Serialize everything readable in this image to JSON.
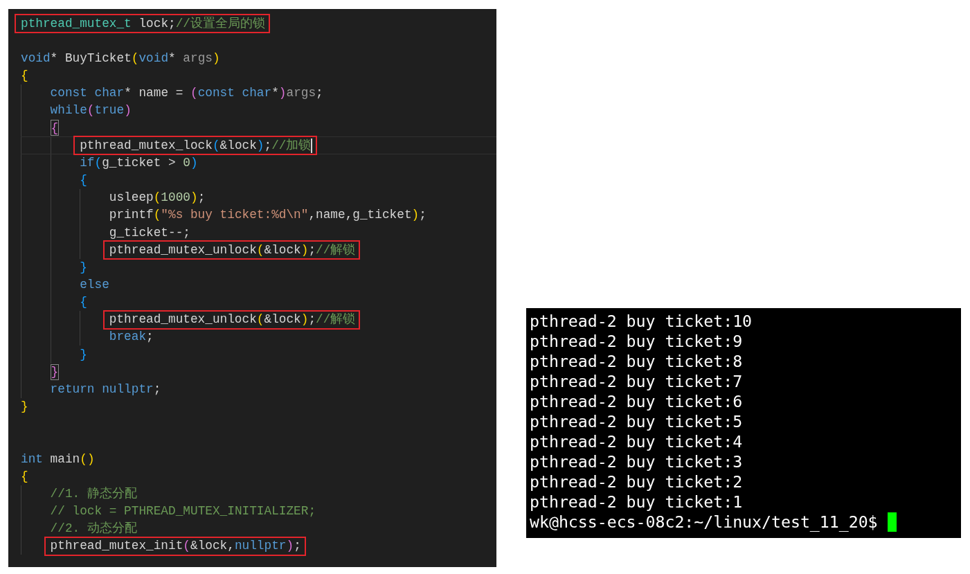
{
  "editor": {
    "lines": [
      {
        "kind": "code",
        "highlighted": true,
        "current": false,
        "matched": false,
        "tokens": [
          {
            "kind": "type",
            "text": "pthread_mutex_t"
          },
          {
            "kind": "plain",
            "text": " lock;"
          },
          {
            "kind": "comment",
            "text": "//设置全局的锁"
          }
        ]
      },
      {
        "kind": "blank"
      },
      {
        "kind": "code",
        "highlighted": false,
        "current": false,
        "matched": false,
        "tokens": [
          {
            "kind": "keyword",
            "text": "void"
          },
          {
            "kind": "plain",
            "text": "* BuyTicket"
          },
          {
            "kind": "bracket1",
            "text": "("
          },
          {
            "kind": "keyword",
            "text": "void"
          },
          {
            "kind": "plain",
            "text": "* "
          },
          {
            "kind": "param",
            "text": "args"
          },
          {
            "kind": "bracket1",
            "text": ")"
          }
        ]
      },
      {
        "kind": "code",
        "highlighted": false,
        "current": false,
        "matched": false,
        "tokens": [
          {
            "kind": "bracket1",
            "text": "{"
          }
        ],
        "children": [
          {
            "kind": "code",
            "highlighted": false,
            "current": false,
            "matched": false,
            "tokens": [
              {
                "kind": "keyword",
                "text": "const char"
              },
              {
                "kind": "plain",
                "text": "* name = "
              },
              {
                "kind": "bracket2",
                "text": "("
              },
              {
                "kind": "keyword",
                "text": "const char"
              },
              {
                "kind": "plain",
                "text": "*"
              },
              {
                "kind": "bracket2",
                "text": ")"
              },
              {
                "kind": "param",
                "text": "args"
              },
              {
                "kind": "plain",
                "text": ";"
              }
            ]
          },
          {
            "kind": "code",
            "highlighted": false,
            "current": false,
            "matched": false,
            "tokens": [
              {
                "kind": "keyword",
                "text": "while"
              },
              {
                "kind": "bracket2",
                "text": "("
              },
              {
                "kind": "keyword",
                "text": "true"
              },
              {
                "kind": "bracket2",
                "text": ")"
              }
            ]
          },
          {
            "kind": "code",
            "highlighted": false,
            "current": false,
            "matched": true,
            "tokens": [
              {
                "kind": "bracket2",
                "text": "{"
              }
            ],
            "children": [
              {
                "kind": "code",
                "highlighted": true,
                "current": true,
                "matched": false,
                "tokens": [
                  {
                    "kind": "plain",
                    "text": "pthread_mutex_lock"
                  },
                  {
                    "kind": "bracket3",
                    "text": "("
                  },
                  {
                    "kind": "plain",
                    "text": "&lock"
                  },
                  {
                    "kind": "bracket3",
                    "text": ")"
                  },
                  {
                    "kind": "plain",
                    "text": ";"
                  },
                  {
                    "kind": "comment",
                    "text": "//加锁"
                  }
                ]
              },
              {
                "kind": "code",
                "highlighted": false,
                "current": false,
                "matched": false,
                "tokens": [
                  {
                    "kind": "keyword",
                    "text": "if"
                  },
                  {
                    "kind": "bracket3",
                    "text": "("
                  },
                  {
                    "kind": "plain",
                    "text": "g_ticket > "
                  },
                  {
                    "kind": "number",
                    "text": "0"
                  },
                  {
                    "kind": "bracket3",
                    "text": ")"
                  }
                ]
              },
              {
                "kind": "code",
                "highlighted": false,
                "current": false,
                "matched": false,
                "tokens": [
                  {
                    "kind": "bracket3",
                    "text": "{"
                  }
                ],
                "children": [
                  {
                    "kind": "code",
                    "highlighted": false,
                    "current": false,
                    "matched": false,
                    "tokens": [
                      {
                        "kind": "plain",
                        "text": "usleep"
                      },
                      {
                        "kind": "bracket1",
                        "text": "("
                      },
                      {
                        "kind": "number",
                        "text": "1000"
                      },
                      {
                        "kind": "bracket1",
                        "text": ")"
                      },
                      {
                        "kind": "plain",
                        "text": ";"
                      }
                    ]
                  },
                  {
                    "kind": "code",
                    "highlighted": false,
                    "current": false,
                    "matched": false,
                    "tokens": [
                      {
                        "kind": "plain",
                        "text": "printf"
                      },
                      {
                        "kind": "bracket1",
                        "text": "("
                      },
                      {
                        "kind": "string",
                        "text": "\"%s buy ticket:%d\\n\""
                      },
                      {
                        "kind": "plain",
                        "text": ",name,g_ticket"
                      },
                      {
                        "kind": "bracket1",
                        "text": ")"
                      },
                      {
                        "kind": "plain",
                        "text": ";"
                      }
                    ]
                  },
                  {
                    "kind": "code",
                    "highlighted": false,
                    "current": false,
                    "matched": false,
                    "tokens": [
                      {
                        "kind": "plain",
                        "text": "g_ticket--;"
                      }
                    ]
                  },
                  {
                    "kind": "code",
                    "highlighted": true,
                    "current": false,
                    "matched": false,
                    "tokens": [
                      {
                        "kind": "plain",
                        "text": "pthread_mutex_unlock"
                      },
                      {
                        "kind": "bracket1",
                        "text": "("
                      },
                      {
                        "kind": "plain",
                        "text": "&lock"
                      },
                      {
                        "kind": "bracket1",
                        "text": ")"
                      },
                      {
                        "kind": "plain",
                        "text": ";"
                      },
                      {
                        "kind": "comment",
                        "text": "//解锁"
                      }
                    ]
                  }
                ]
              },
              {
                "kind": "code",
                "highlighted": false,
                "current": false,
                "matched": false,
                "tokens": [
                  {
                    "kind": "bracket3",
                    "text": "}"
                  }
                ]
              },
              {
                "kind": "code",
                "highlighted": false,
                "current": false,
                "matched": false,
                "tokens": [
                  {
                    "kind": "keyword",
                    "text": "else"
                  }
                ]
              },
              {
                "kind": "code",
                "highlighted": false,
                "current": false,
                "matched": false,
                "tokens": [
                  {
                    "kind": "bracket3",
                    "text": "{"
                  }
                ],
                "children": [
                  {
                    "kind": "code",
                    "highlighted": true,
                    "current": false,
                    "matched": false,
                    "tokens": [
                      {
                        "kind": "plain",
                        "text": "pthread_mutex_unlock"
                      },
                      {
                        "kind": "bracket1",
                        "text": "("
                      },
                      {
                        "kind": "plain",
                        "text": "&lock"
                      },
                      {
                        "kind": "bracket1",
                        "text": ")"
                      },
                      {
                        "kind": "plain",
                        "text": ";"
                      },
                      {
                        "kind": "comment",
                        "text": "//解锁"
                      }
                    ]
                  },
                  {
                    "kind": "code",
                    "highlighted": false,
                    "current": false,
                    "matched": false,
                    "tokens": [
                      {
                        "kind": "keyword",
                        "text": "break"
                      },
                      {
                        "kind": "plain",
                        "text": ";"
                      }
                    ]
                  }
                ]
              },
              {
                "kind": "code",
                "highlighted": false,
                "current": false,
                "matched": false,
                "tokens": [
                  {
                    "kind": "bracket3",
                    "text": "}"
                  }
                ]
              }
            ]
          },
          {
            "kind": "code",
            "highlighted": false,
            "current": false,
            "matched": true,
            "tokens": [
              {
                "kind": "bracket2",
                "text": "}"
              }
            ]
          },
          {
            "kind": "code",
            "highlighted": false,
            "current": false,
            "matched": false,
            "tokens": [
              {
                "kind": "keyword",
                "text": "return nullptr"
              },
              {
                "kind": "plain",
                "text": ";"
              }
            ]
          }
        ]
      },
      {
        "kind": "code",
        "highlighted": false,
        "current": false,
        "matched": false,
        "tokens": [
          {
            "kind": "bracket1",
            "text": "}"
          }
        ]
      },
      {
        "kind": "blank"
      },
      {
        "kind": "blank"
      },
      {
        "kind": "code",
        "highlighted": false,
        "current": false,
        "matched": false,
        "tokens": [
          {
            "kind": "keyword",
            "text": "int"
          },
          {
            "kind": "plain",
            "text": " main"
          },
          {
            "kind": "bracket1",
            "text": "()"
          }
        ]
      },
      {
        "kind": "code",
        "highlighted": false,
        "current": false,
        "matched": false,
        "tokens": [
          {
            "kind": "bracket1",
            "text": "{"
          }
        ],
        "children": [
          {
            "kind": "code",
            "highlighted": false,
            "current": false,
            "matched": false,
            "tokens": [
              {
                "kind": "comment",
                "text": "//1. 静态分配"
              }
            ]
          },
          {
            "kind": "code",
            "highlighted": false,
            "current": false,
            "matched": false,
            "tokens": [
              {
                "kind": "comment",
                "text": "// lock = PTHREAD_MUTEX_INITIALIZER;"
              }
            ]
          },
          {
            "kind": "code",
            "highlighted": false,
            "current": false,
            "matched": false,
            "tokens": [
              {
                "kind": "comment",
                "text": "//2. 动态分配"
              }
            ]
          },
          {
            "kind": "code",
            "highlighted": true,
            "current": false,
            "matched": false,
            "tokens": [
              {
                "kind": "plain",
                "text": "pthread_mutex_init"
              },
              {
                "kind": "bracket2",
                "text": "("
              },
              {
                "kind": "plain",
                "text": "&lock,"
              },
              {
                "kind": "keyword",
                "text": "nullptr"
              },
              {
                "kind": "bracket2",
                "text": ")"
              },
              {
                "kind": "plain",
                "text": ";"
              }
            ]
          }
        ]
      }
    ]
  },
  "terminal": {
    "lines": [
      "pthread-2 buy ticket:10",
      "pthread-2 buy ticket:9",
      "pthread-2 buy ticket:8",
      "pthread-2 buy ticket:7",
      "pthread-2 buy ticket:6",
      "pthread-2 buy ticket:5",
      "pthread-2 buy ticket:4",
      "pthread-2 buy ticket:3",
      "pthread-2 buy ticket:2",
      "pthread-2 buy ticket:1"
    ],
    "prompt": "wk@hcss-ecs-08c2:~/linux/test_11_20$"
  }
}
